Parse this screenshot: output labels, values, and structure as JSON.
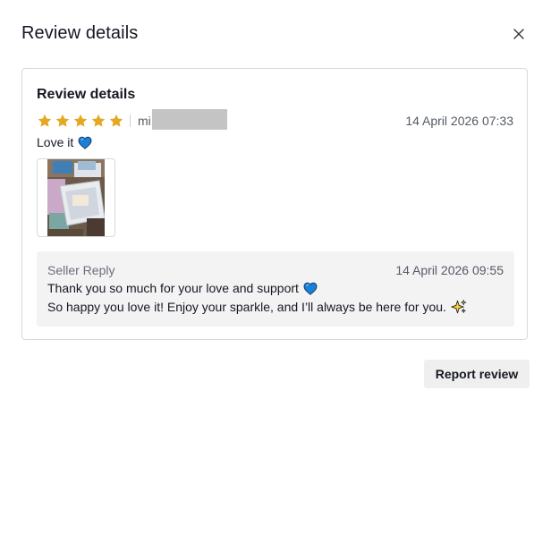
{
  "dialog": {
    "title": "Review details",
    "close_icon": "close-icon"
  },
  "review": {
    "section_title": "Review details",
    "rating": 5,
    "max_rating": 5,
    "star_color": "#e5a823",
    "username_visible": "mi",
    "date": "14 April 2026 07:33",
    "text": "Love it",
    "text_emoji_icon": "blue-heart-icon",
    "photo_icon": "review-photo-thumbnail"
  },
  "seller_reply": {
    "label": "Seller Reply",
    "date": "14 April 2026 09:55",
    "line1": "Thank you so much for your love and support",
    "line1_emoji_icon": "blue-heart-icon",
    "line2": "So happy you love it! Enjoy your sparkle, and I’ll always be here for you.",
    "line2_emoji_icon": "sparkles-icon"
  },
  "actions": {
    "report_label": "Report review"
  },
  "colors": {
    "heart_blue": "#1a7fd6",
    "reply_background": "#f3f3f4",
    "button_background": "#efefef"
  }
}
